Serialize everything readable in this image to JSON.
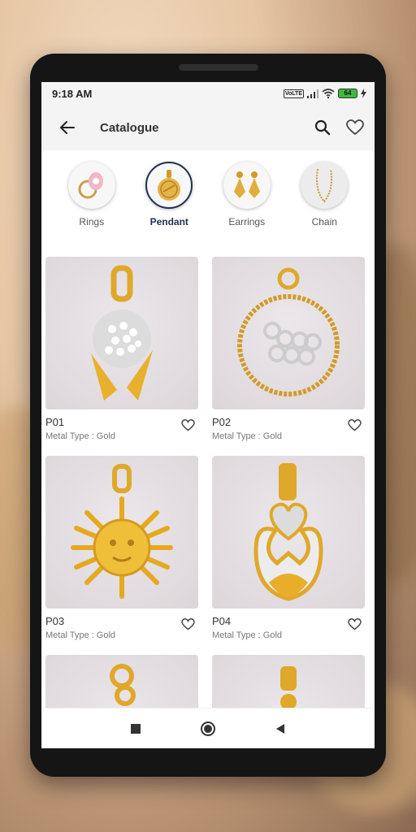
{
  "status_bar": {
    "time": "9:18 AM",
    "volte": "VoLTE",
    "battery_level": "64"
  },
  "app_bar": {
    "title": "Catalogue",
    "back_icon": "arrow-left-icon",
    "search_icon": "search-icon",
    "wishlist_icon": "heart-outline-icon"
  },
  "categories": [
    {
      "label": "Rings",
      "active": false
    },
    {
      "label": "Pendant",
      "active": true
    },
    {
      "label": "Earrings",
      "active": false
    },
    {
      "label": "Chain",
      "active": false
    }
  ],
  "products": [
    {
      "code": "P01",
      "metal_type": "Metal Type  :  Gold"
    },
    {
      "code": "P02",
      "metal_type": "Metal Type  :  Gold"
    },
    {
      "code": "P03",
      "metal_type": "Metal Type  :  Gold"
    },
    {
      "code": "P04",
      "metal_type": "Metal Type  :  Gold"
    }
  ],
  "colors": {
    "accent": "#22314f",
    "gold": "#e0a82a",
    "background": "#ffffff",
    "bar": "#f4f4f4"
  },
  "nav_bar": {
    "icons": [
      "square-recents-icon",
      "circle-home-icon",
      "triangle-back-icon"
    ]
  }
}
